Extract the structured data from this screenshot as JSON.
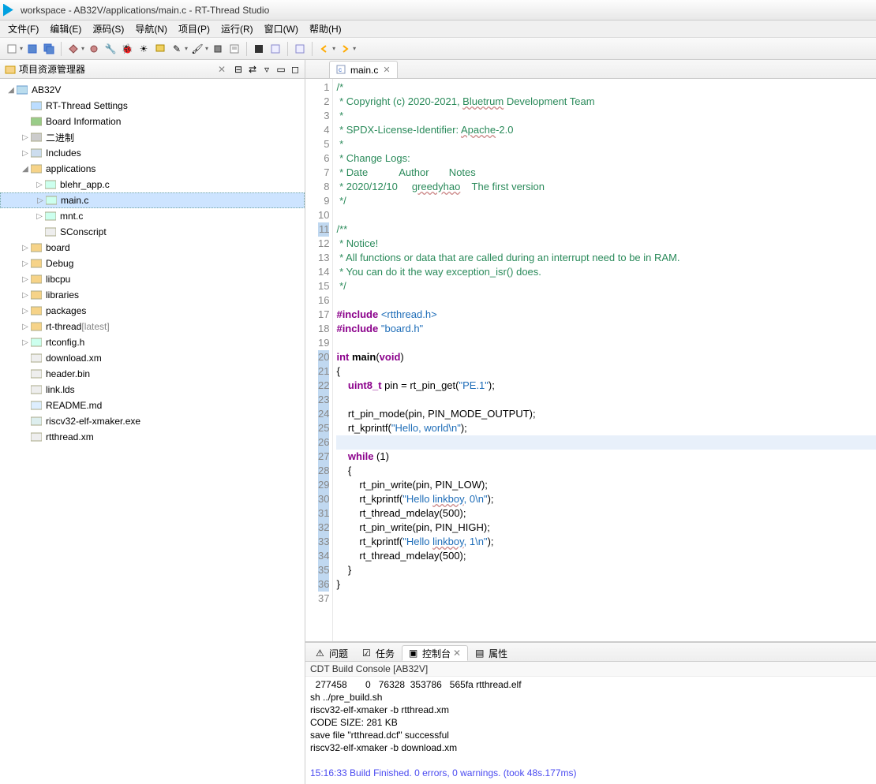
{
  "window": {
    "title": "workspace - AB32V/applications/main.c - RT-Thread Studio"
  },
  "menu": [
    "文件(F)",
    "编辑(E)",
    "源码(S)",
    "导航(N)",
    "项目(P)",
    "运行(R)",
    "窗口(W)",
    "帮助(H)"
  ],
  "explorer": {
    "title": "项目资源管理器",
    "root": "AB32V",
    "items": [
      {
        "label": "RT-Thread Settings",
        "icon": "rt",
        "depth": 1
      },
      {
        "label": "Board Information",
        "icon": "board",
        "depth": 1
      },
      {
        "label": "二进制",
        "icon": "bin",
        "depth": 1,
        "exp": "▷"
      },
      {
        "label": "Includes",
        "icon": "inc",
        "depth": 1,
        "exp": "▷"
      },
      {
        "label": "applications",
        "icon": "folder",
        "depth": 1,
        "exp": "◢"
      },
      {
        "label": "blehr_app.c",
        "icon": "c",
        "depth": 2,
        "exp": "▷"
      },
      {
        "label": "main.c",
        "icon": "c",
        "depth": 2,
        "exp": "▷",
        "selected": true
      },
      {
        "label": "mnt.c",
        "icon": "c",
        "depth": 2,
        "exp": "▷"
      },
      {
        "label": "SConscript",
        "icon": "file",
        "depth": 2
      },
      {
        "label": "board",
        "icon": "folder",
        "depth": 1,
        "exp": "▷"
      },
      {
        "label": "Debug",
        "icon": "folder",
        "depth": 1,
        "exp": "▷"
      },
      {
        "label": "libcpu",
        "icon": "folder",
        "depth": 1,
        "exp": "▷"
      },
      {
        "label": "libraries",
        "icon": "folder",
        "depth": 1,
        "exp": "▷"
      },
      {
        "label": "packages",
        "icon": "folder",
        "depth": 1,
        "exp": "▷"
      },
      {
        "label": "rt-thread",
        "icon": "folder",
        "depth": 1,
        "exp": "▷",
        "annot": "[latest]"
      },
      {
        "label": "rtconfig.h",
        "icon": "h",
        "depth": 1,
        "exp": "▷"
      },
      {
        "label": "download.xm",
        "icon": "file",
        "depth": 1
      },
      {
        "label": "header.bin",
        "icon": "file",
        "depth": 1
      },
      {
        "label": "link.lds",
        "icon": "file",
        "depth": 1
      },
      {
        "label": "README.md",
        "icon": "md",
        "depth": 1
      },
      {
        "label": "riscv32-elf-xmaker.exe",
        "icon": "exe",
        "depth": 1
      },
      {
        "label": "rtthread.xm",
        "icon": "file",
        "depth": 1
      }
    ]
  },
  "editor": {
    "tab": "main.c",
    "lines": [
      {
        "n": 1,
        "h": "<span class='c-comment'>/*</span>"
      },
      {
        "n": 2,
        "h": "<span class='c-comment'> * Copyright (c) 2020-2021, <span class='c-under'>Bluetrum</span> Development Team</span>"
      },
      {
        "n": 3,
        "h": "<span class='c-comment'> *</span>"
      },
      {
        "n": 4,
        "h": "<span class='c-comment'> * SPDX-License-Identifier: <span class='c-under'>Apache</span>-2.0</span>"
      },
      {
        "n": 5,
        "h": "<span class='c-comment'> *</span>"
      },
      {
        "n": 6,
        "h": "<span class='c-comment'> * Change Logs:</span>"
      },
      {
        "n": 7,
        "h": "<span class='c-comment'> * Date           Author       Notes</span>"
      },
      {
        "n": 8,
        "h": "<span class='c-comment'> * 2020/12/10     <span class='c-under'>greedyhao</span>    The first version</span>"
      },
      {
        "n": 9,
        "h": "<span class='c-comment'> */</span>"
      },
      {
        "n": 10,
        "h": ""
      },
      {
        "n": 11,
        "h": "<span class='c-comment'>/**</span>",
        "mark": true
      },
      {
        "n": 12,
        "h": "<span class='c-comment'> * Notice!</span>"
      },
      {
        "n": 13,
        "h": "<span class='c-comment'> * All functions or data that are called during an interrupt need to be in RAM.</span>"
      },
      {
        "n": 14,
        "h": "<span class='c-comment'> * You can do it the way exception_isr() does.</span>"
      },
      {
        "n": 15,
        "h": "<span class='c-comment'> */</span>"
      },
      {
        "n": 16,
        "h": ""
      },
      {
        "n": 17,
        "h": "<span class='c-kw'>#include</span> <span class='c-inc'>&lt;rtthread.h&gt;</span>"
      },
      {
        "n": 18,
        "h": "<span class='c-kw'>#include</span> <span class='c-inc'>\"board.h\"</span>"
      },
      {
        "n": 19,
        "h": ""
      },
      {
        "n": 20,
        "h": "<span class='c-kw'>int</span> <span class='c-func'>main</span>(<span class='c-kw'>void</span>)",
        "mark": true
      },
      {
        "n": 21,
        "h": "{",
        "mark": true
      },
      {
        "n": 22,
        "h": "    <span class='c-type'>uint8_t</span> pin = rt_pin_get(<span class='c-str'>\"PE.1\"</span>);",
        "mark": true
      },
      {
        "n": 23,
        "h": "",
        "mark": true
      },
      {
        "n": 24,
        "h": "    rt_pin_mode(pin, PIN_MODE_OUTPUT);",
        "mark": true
      },
      {
        "n": 25,
        "h": "    rt_kprintf(<span class='c-str'>\"Hello, world\\n\"</span>);",
        "mark": true
      },
      {
        "n": 26,
        "h": "",
        "mark": true,
        "hl": true
      },
      {
        "n": 27,
        "h": "    <span class='c-kw'>while</span> (1)",
        "mark": true
      },
      {
        "n": 28,
        "h": "    {",
        "mark": true
      },
      {
        "n": 29,
        "h": "        rt_pin_write(pin, PIN_LOW);",
        "mark": true
      },
      {
        "n": 30,
        "h": "        rt_kprintf(<span class='c-str'>\"Hello <span class='c-under'>linkboy</span>, 0\\n\"</span>);",
        "mark": true
      },
      {
        "n": 31,
        "h": "        rt_thread_mdelay(500);",
        "mark": true
      },
      {
        "n": 32,
        "h": "        rt_pin_write(pin, PIN_HIGH);",
        "mark": true
      },
      {
        "n": 33,
        "h": "        rt_kprintf(<span class='c-str'>\"Hello <span class='c-under'>linkboy</span>, 1\\n\"</span>);",
        "mark": true
      },
      {
        "n": 34,
        "h": "        rt_thread_mdelay(500);",
        "mark": true
      },
      {
        "n": 35,
        "h": "    }",
        "mark": true
      },
      {
        "n": 36,
        "h": "}",
        "mark": true
      },
      {
        "n": 37,
        "h": ""
      }
    ]
  },
  "bottom": {
    "tabs": [
      {
        "label": "问题",
        "icon": "warn"
      },
      {
        "label": "任务",
        "icon": "task"
      },
      {
        "label": "控制台",
        "icon": "console",
        "active": true
      },
      {
        "label": "属性",
        "icon": "prop"
      }
    ],
    "consoleTitle": "CDT Build Console [AB32V]",
    "lines": [
      "  277458       0   76328  353786   565fa rtthread.elf",
      "sh ../pre_build.sh",
      "riscv32-elf-xmaker -b rtthread.xm",
      "CODE SIZE: 281 KB",
      "save file \"rtthread.dcf\" successful",
      "riscv32-elf-xmaker -b download.xm",
      "",
      "15:16:33 Build Finished. 0 errors, 0 warnings. (took 48s.177ms)"
    ]
  }
}
